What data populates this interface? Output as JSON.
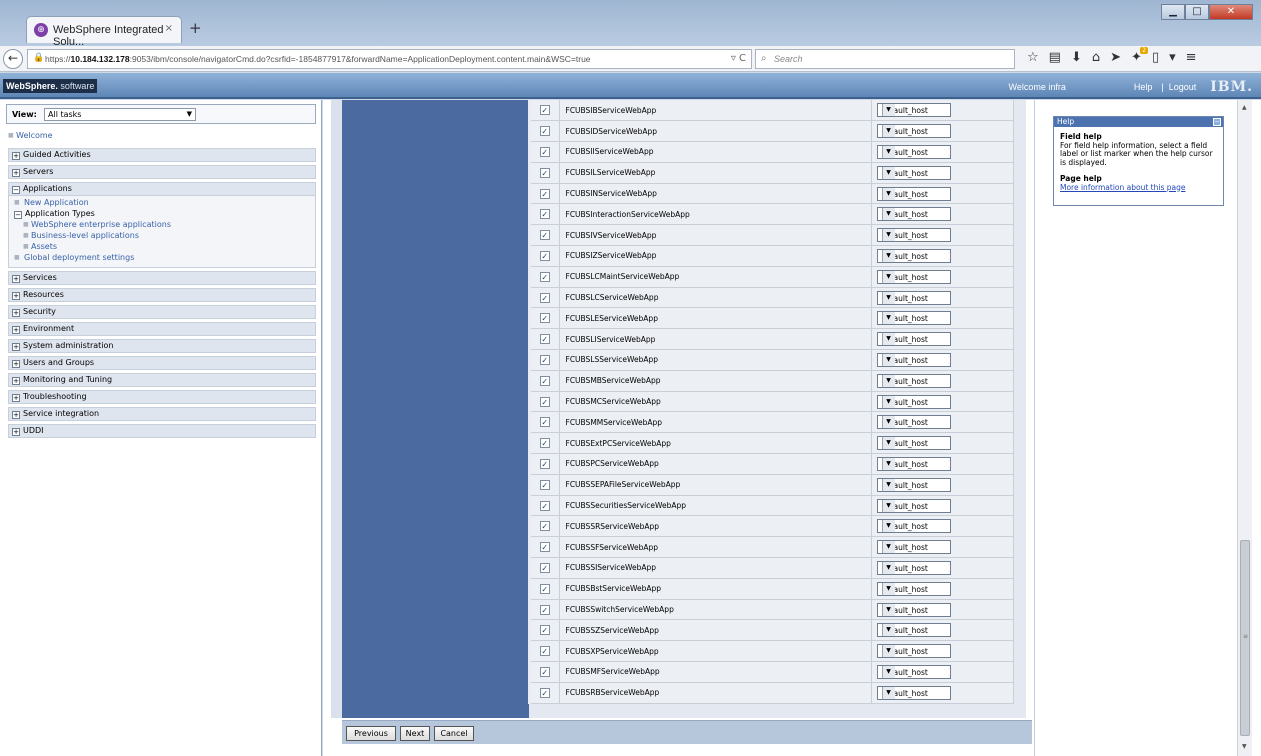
{
  "browser": {
    "tab_title": "WebSphere Integrated Solu...",
    "tab_close": "×",
    "new_tab": "+",
    "url_prefix": "https://",
    "url_host": "10.184.132.178",
    "url_rest": ":9053/ibm/console/navigatorCmd.do?csrfid=-1854877917&forwardName=ApplicationDeployment.content.main&WSC=true",
    "search_placeholder": "Search"
  },
  "banner": {
    "brand": "WebSphere.",
    "brand_suffix": " software",
    "welcome": "Welcome infra",
    "help": "Help",
    "separator": "|",
    "logout": "Logout",
    "logo": "IBM."
  },
  "nav": {
    "view_label": "View:",
    "view_value": "All tasks",
    "welcome": "Welcome",
    "guided_activities": "Guided Activities",
    "servers": "Servers",
    "applications": "Applications",
    "new_application": "New Application",
    "application_types": "Application Types",
    "websphere_enterprise_apps": "WebSphere enterprise applications",
    "business_level_apps": "Business-level applications",
    "assets": "Assets",
    "global_deployment": "Global deployment settings",
    "services": "Services",
    "resources": "Resources",
    "security": "Security",
    "environment": "Environment",
    "system_administration": "System administration",
    "users_and_groups": "Users and Groups",
    "monitoring_and_tuning": "Monitoring and Tuning",
    "troubleshooting": "Troubleshooting",
    "service_integration": "Service integration",
    "uddi": "UDDI"
  },
  "table": {
    "host_value": "default_host",
    "rows": [
      "FCUBSIBServiceWebApp",
      "FCUBSIDServiceWebApp",
      "FCUBSIIServiceWebApp",
      "FCUBSILServiceWebApp",
      "FCUBSINServiceWebApp",
      "FCUBSInteractionServiceWebApp",
      "FCUBSIVServiceWebApp",
      "FCUBSIZServiceWebApp",
      "FCUBSLCMaintServiceWebApp",
      "FCUBSLCServiceWebApp",
      "FCUBSLEServiceWebApp",
      "FCUBSLIServiceWebApp",
      "FCUBSLSServiceWebApp",
      "FCUBSMBServiceWebApp",
      "FCUBSMCServiceWebApp",
      "FCUBSMMServiceWebApp",
      "FCUBSExtPCServiceWebApp",
      "FCUBSPCServiceWebApp",
      "FCUBSSEPAFileServiceWebApp",
      "FCUBSSecuritiesServiceWebApp",
      "FCUBSSRServiceWebApp",
      "FCUBSSFServiceWebApp",
      "FCUBSSIServiceWebApp",
      "FCUBSBstServiceWebApp",
      "FCUBSSwitchServiceWebApp",
      "FCUBSSZServiceWebApp",
      "FCUBSXPServiceWebApp",
      "FCUBSMFServiceWebApp",
      "FCUBSRBServiceWebApp"
    ]
  },
  "buttons": {
    "previous": "Previous",
    "next": "Next",
    "cancel": "Cancel"
  },
  "help": {
    "title": "Help",
    "field_help_heading": "Field help",
    "field_help_text": "For field help information, select a field label or list marker when the help cursor is displayed.",
    "page_help_heading": "Page help",
    "page_help_link": "More information about this page"
  }
}
